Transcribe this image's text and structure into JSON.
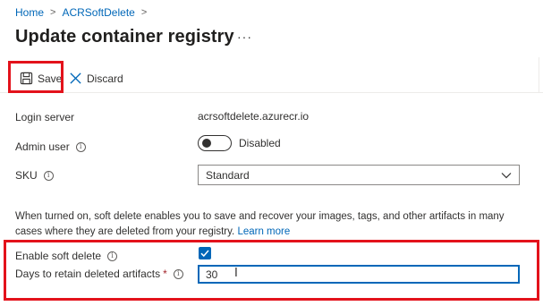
{
  "breadcrumb": {
    "items": [
      "Home",
      "ACRSoftDelete"
    ],
    "separator": ">"
  },
  "header": {
    "title": "Update container registry",
    "more_label": "···"
  },
  "toolbar": {
    "save_label": "Save",
    "discard_label": "Discard"
  },
  "form": {
    "login_server": {
      "label": "Login server",
      "value": "acrsoftdelete.azurecr.io"
    },
    "admin_user": {
      "label": "Admin user",
      "toggle_state": "Disabled",
      "enabled": false
    },
    "sku": {
      "label": "SKU",
      "selected": "Standard"
    },
    "soft_delete_description": "When turned on, soft delete enables you to save and recover your images, tags, and other artifacts in many cases where they are deleted from your registry.",
    "learn_more_label": "Learn more",
    "enable_soft_delete": {
      "label": "Enable soft delete",
      "checked": true
    },
    "retention_days": {
      "label": "Days to retain deleted artifacts",
      "required_mark": "*",
      "value": "30"
    }
  },
  "colors": {
    "accent": "#0067b8",
    "highlight": "#e3121b",
    "text": "#323130"
  },
  "icons": {
    "save": "save-icon",
    "discard": "close-icon",
    "info": "info-icon",
    "dropdown": "chevron-down-icon",
    "checkbox": "checkmark-icon"
  }
}
